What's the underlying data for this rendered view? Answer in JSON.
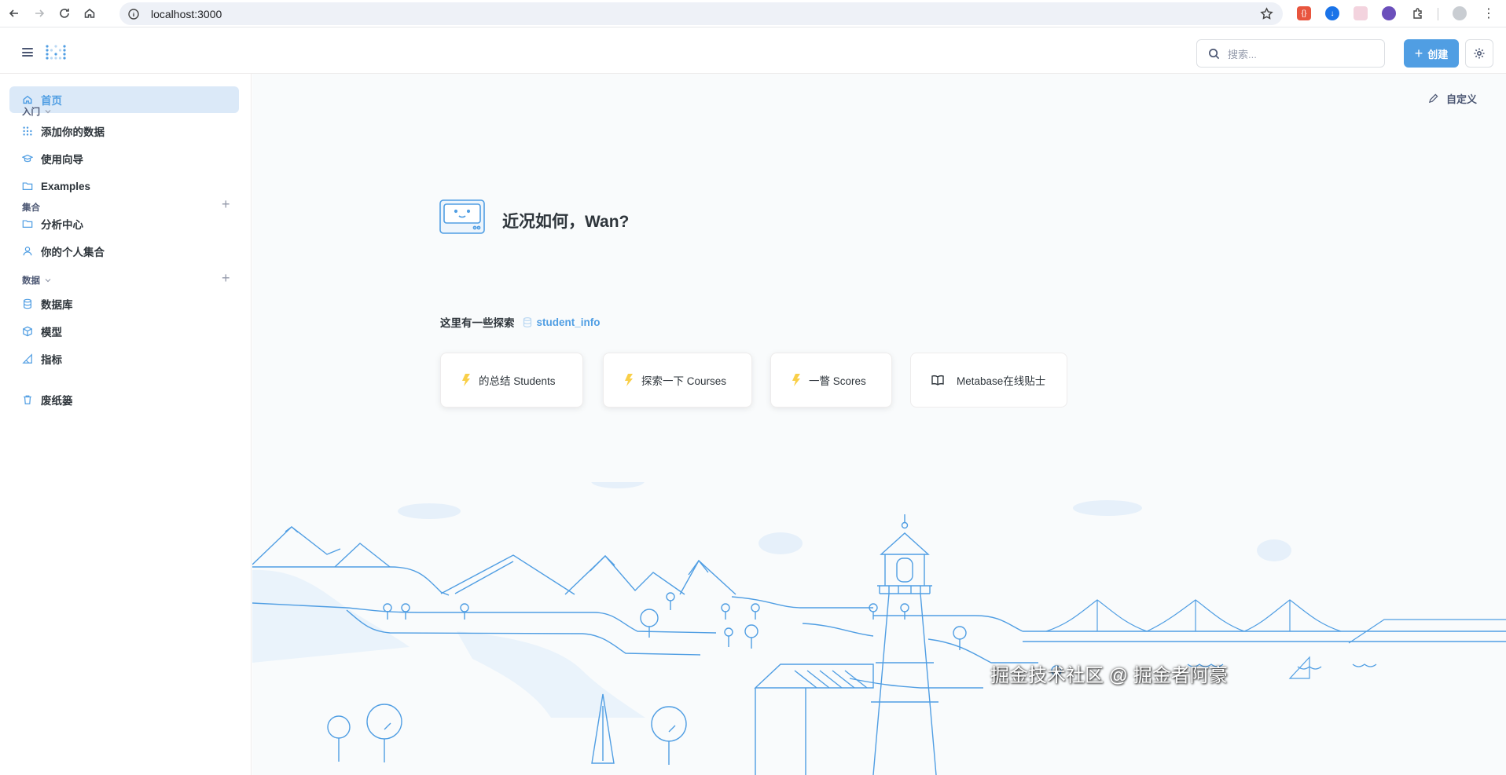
{
  "browser": {
    "url": "localhost:3000"
  },
  "header": {
    "search_placeholder": "搜索...",
    "create_label": "创建"
  },
  "sidebar": {
    "home": "首页",
    "getting_started": {
      "title": "入门",
      "items": [
        "添加你的数据",
        "使用向导",
        "Examples"
      ]
    },
    "collections": {
      "title": "集合",
      "items": [
        "分析中心",
        "你的个人集合"
      ]
    },
    "data": {
      "title": "数据",
      "items": [
        "数据库",
        "模型",
        "指标"
      ]
    },
    "trash": "废纸篓"
  },
  "main": {
    "customize": "自定义",
    "greeting": "近况如何，Wan?",
    "explore_label": "这里有一些探索",
    "explore_db": "student_info",
    "cards": [
      "的总结 Students",
      "探索一下 Courses",
      "一瞥 Scores",
      "Metabase在线贴士"
    ]
  },
  "watermark": "掘金技术社区 @ 掘金者阿豪",
  "colors": {
    "brand": "#509ee3",
    "brand_light": "#dbe9f8",
    "bolt": "#f9cf48"
  }
}
